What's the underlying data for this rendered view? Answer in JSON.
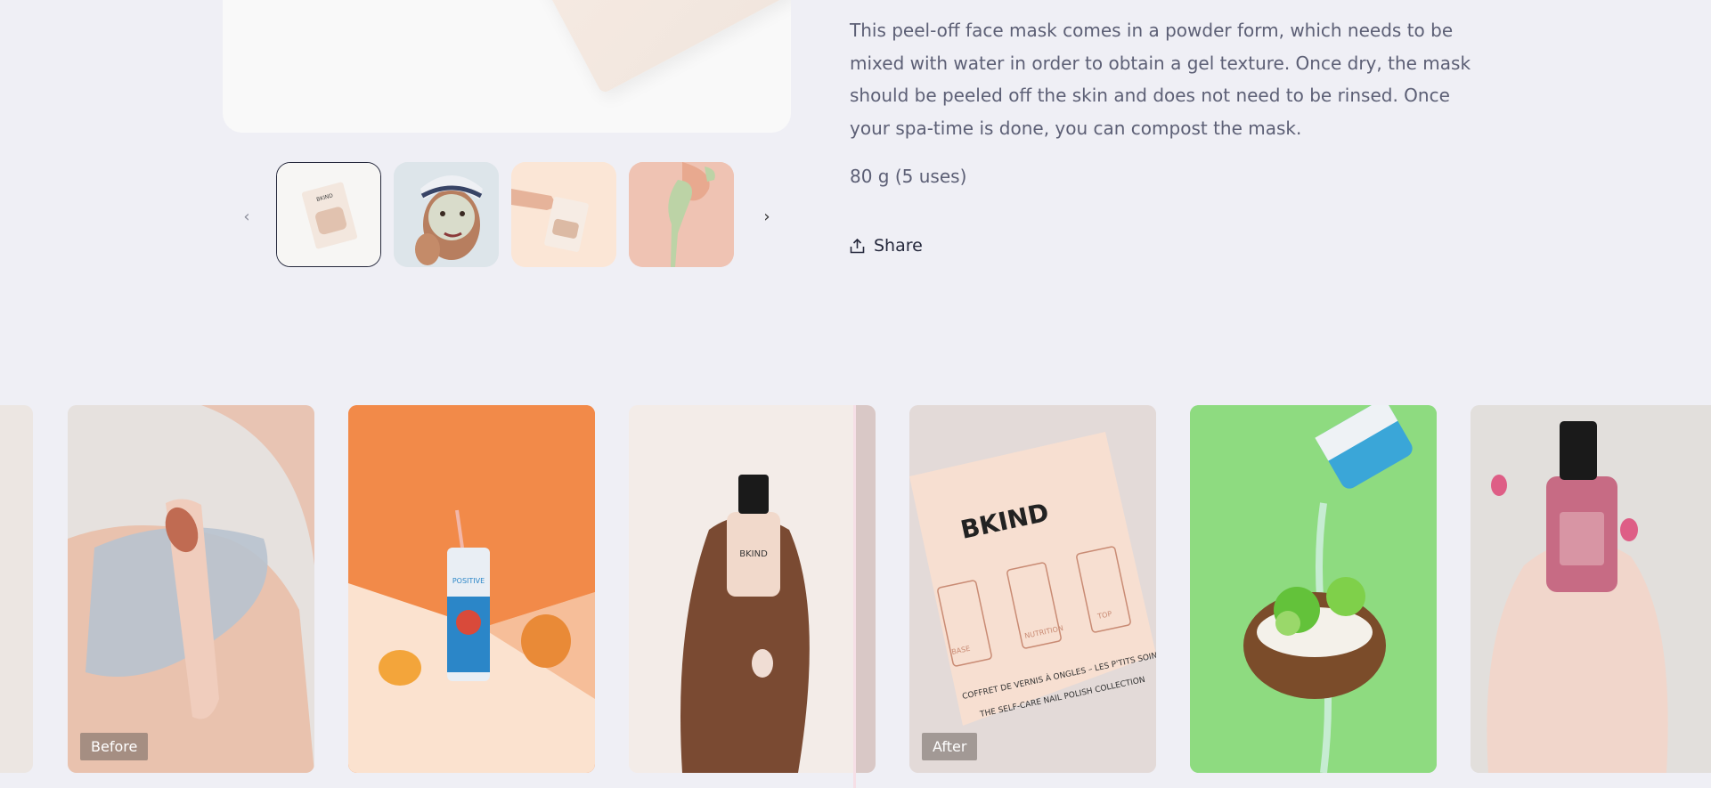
{
  "product": {
    "description": "This peel-off face mask comes in a powder form, which needs to be mixed with water in order to obtain a gel texture. Once dry, the mask should be peeled off the skin and does not need to be rinsed. Once your spa-time is done, you can compost the mask.",
    "size": "80 g (5 uses)",
    "share_label": "Share"
  },
  "gallery": {
    "prev_icon": "‹",
    "next_icon": "›",
    "pkg_brand": "BKIND"
  },
  "comparison": {
    "before_label": "Before",
    "after_label": "After"
  },
  "tiles": {
    "nail_brand": "BKIND",
    "kit_brand": "BKIND",
    "kit_line1": "COFFRET DE VERNIS À ONGLES – LES P'TITS SOINS",
    "kit_line2": "THE SELF-CARE NAIL POLISH COLLECTION",
    "kit_base": "BASE",
    "kit_nutrition": "NUTRITION",
    "kit_top": "TOP",
    "can_brand": "POSITIVE"
  },
  "colors": {
    "background": "#efeff5",
    "text": "#5c5f75",
    "dark": "#25283c",
    "orange": "#f28a49",
    "green": "#8fdb82"
  }
}
